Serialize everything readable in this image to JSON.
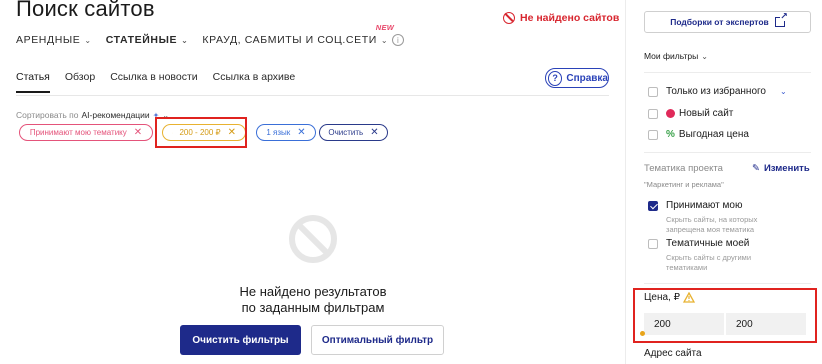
{
  "header": {
    "title": "Поиск сайтов",
    "not_found": "Не найдено сайтов"
  },
  "categories": [
    {
      "label": "АРЕНДНЫЕ"
    },
    {
      "label": "СТАТЕЙНЫЕ"
    },
    {
      "label": "КРАУД, САБМИТЫ И СОЦ.СЕТИ",
      "badge": "NEW"
    }
  ],
  "tabs": [
    {
      "label": "Статья"
    },
    {
      "label": "Обзор"
    },
    {
      "label": "Ссылка в новости"
    },
    {
      "label": "Ссылка в архиве"
    }
  ],
  "help_label": "Справка",
  "sort": {
    "prefix": "Сортировать по",
    "value": "AI-рекомендации"
  },
  "chips": [
    {
      "label": "Принимают мою тематику"
    },
    {
      "label": "200 - 200 ₽"
    },
    {
      "label": "1 язык"
    },
    {
      "label": "Очистить"
    }
  ],
  "empty": {
    "line1": "Не найдено результатов",
    "line2": "по заданным фильтрам",
    "primary_btn": "Очистить фильтры",
    "secondary_btn": "Оптимальный фильтр"
  },
  "sidebar": {
    "expert_btn": "Подборки от экспертов",
    "my_filters": "Мои фильтры",
    "favorites": "Только из избранного",
    "new_site": "Новый сайт",
    "good_price": "Выгодная цена",
    "theme_title": "Тематика проекта",
    "theme_edit": "Изменить",
    "theme_value": "\"Маркетинг и реклама\"",
    "accept_label": "Принимают мою",
    "accept_hint": "Скрыть сайты, на которых запрещена моя тематика",
    "similar_label": "Тематичные моей",
    "similar_hint": "Скрыть сайты с другими тематиками",
    "price_label": "Цена, ₽",
    "price_min": "200",
    "price_max": "200",
    "address_label": "Адрес сайта"
  },
  "colors": {
    "accent": "#1e2a8a",
    "alert": "#d8262f",
    "highlight": "#e0231f",
    "warning": "#e8b230"
  }
}
